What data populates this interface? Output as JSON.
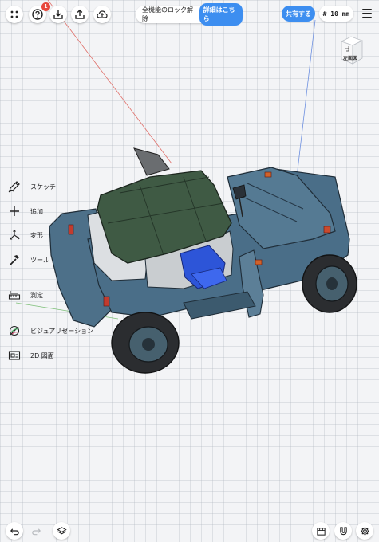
{
  "toolbar": {
    "notification_count": "1",
    "unlock_text": "全機能のロック解除",
    "unlock_link": "詳細はこちら",
    "share_label": "共有する",
    "grid_label": "# 10 mm"
  },
  "view_cube": {
    "label": "左面図"
  },
  "tools": [
    {
      "label": "スケッチ",
      "icon": "pencil-icon"
    },
    {
      "label": "追加",
      "icon": "plus-icon"
    },
    {
      "label": "変形",
      "icon": "transform-icon"
    },
    {
      "label": "ツール",
      "icon": "hammer-icon"
    },
    {
      "label": "測定",
      "icon": "ruler-icon"
    },
    {
      "label": "ビジュアリゼーション",
      "icon": "visualization-icon"
    },
    {
      "label": "2D 図面",
      "icon": "drawing-icon"
    }
  ],
  "colors": {
    "accent": "#3d8ef0",
    "badge": "#e8473b",
    "body_blue": "#4a6e88",
    "roof_green": "#3f5a44"
  }
}
